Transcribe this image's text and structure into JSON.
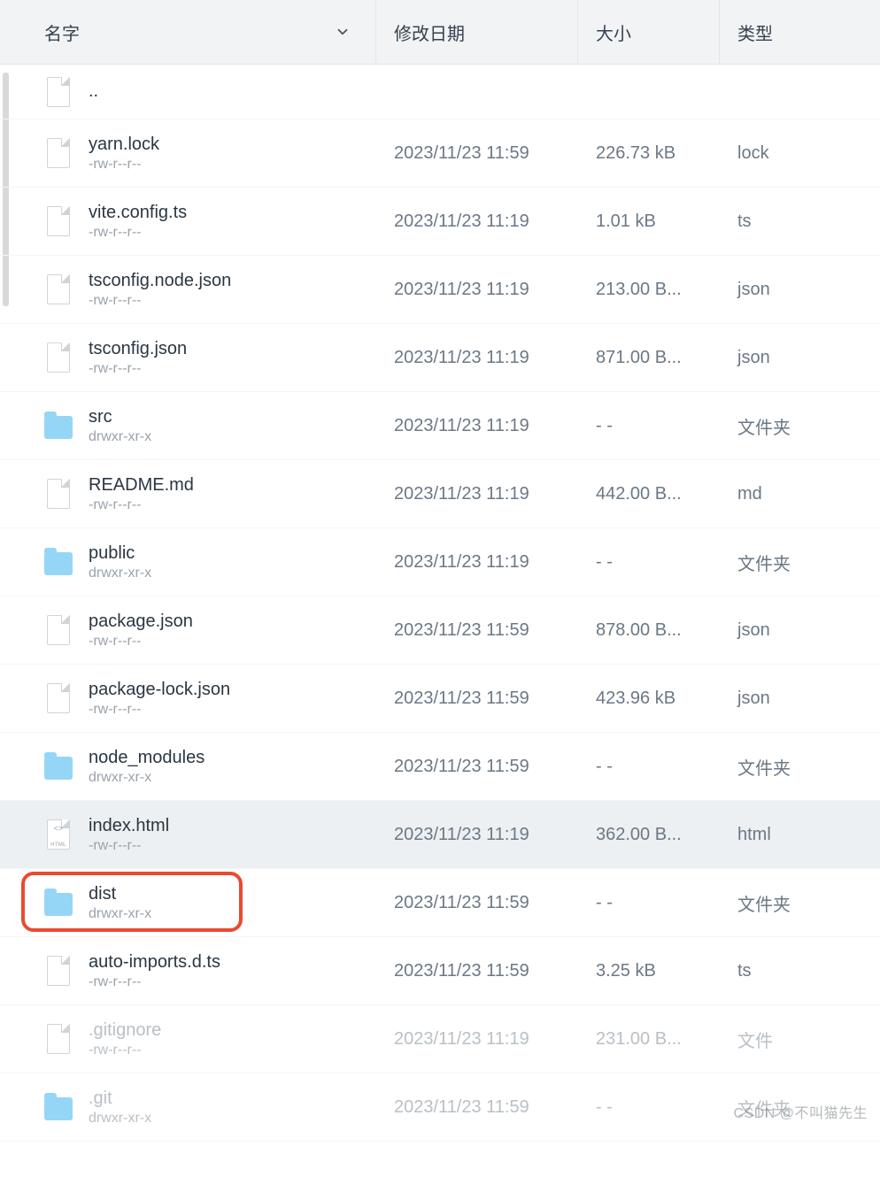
{
  "columns": {
    "name": "名字",
    "date": "修改日期",
    "size": "大小",
    "type": "类型"
  },
  "parent_label": "..",
  "folder_type_label": "文件夹",
  "file_type_label": "文件",
  "rows": [
    {
      "icon": "file",
      "name": "yarn.lock",
      "perms": "-rw-r--r--",
      "date": "2023/11/23 11:59",
      "size": "226.73 kB",
      "type": "lock"
    },
    {
      "icon": "file",
      "name": "vite.config.ts",
      "perms": "-rw-r--r--",
      "date": "2023/11/23 11:19",
      "size": "1.01 kB",
      "type": "ts"
    },
    {
      "icon": "file",
      "name": "tsconfig.node.json",
      "perms": "-rw-r--r--",
      "date": "2023/11/23 11:19",
      "size": "213.00 B...",
      "type": "json"
    },
    {
      "icon": "file",
      "name": "tsconfig.json",
      "perms": "-rw-r--r--",
      "date": "2023/11/23 11:19",
      "size": "871.00 B...",
      "type": "json"
    },
    {
      "icon": "folder",
      "name": "src",
      "perms": "drwxr-xr-x",
      "date": "2023/11/23 11:19",
      "size": "- -",
      "type": "文件夹"
    },
    {
      "icon": "file",
      "name": "README.md",
      "perms": "-rw-r--r--",
      "date": "2023/11/23 11:19",
      "size": "442.00 B...",
      "type": "md"
    },
    {
      "icon": "folder",
      "name": "public",
      "perms": "drwxr-xr-x",
      "date": "2023/11/23 11:19",
      "size": "- -",
      "type": "文件夹"
    },
    {
      "icon": "file",
      "name": "package.json",
      "perms": "-rw-r--r--",
      "date": "2023/11/23 11:59",
      "size": "878.00 B...",
      "type": "json"
    },
    {
      "icon": "file",
      "name": "package-lock.json",
      "perms": "-rw-r--r--",
      "date": "2023/11/23 11:59",
      "size": "423.96 kB",
      "type": "json"
    },
    {
      "icon": "folder",
      "name": "node_modules",
      "perms": "drwxr-xr-x",
      "date": "2023/11/23 11:59",
      "size": "- -",
      "type": "文件夹"
    },
    {
      "icon": "html",
      "name": "index.html",
      "perms": "-rw-r--r--",
      "date": "2023/11/23 11:19",
      "size": "362.00 B...",
      "type": "html",
      "hovered": true
    },
    {
      "icon": "folder",
      "name": "dist",
      "perms": "drwxr-xr-x",
      "date": "2023/11/23 11:59",
      "size": "- -",
      "type": "文件夹",
      "highlighted": true
    },
    {
      "icon": "file",
      "name": "auto-imports.d.ts",
      "perms": "-rw-r--r--",
      "date": "2023/11/23 11:59",
      "size": "3.25 kB",
      "type": "ts"
    },
    {
      "icon": "file",
      "name": ".gitignore",
      "perms": "-rw-r--r--",
      "date": "2023/11/23 11:19",
      "size": "231.00 B...",
      "type": "文件",
      "faded": true
    },
    {
      "icon": "folder",
      "name": ".git",
      "perms": "drwxr-xr-x",
      "date": "2023/11/23 11:59",
      "size": "- -",
      "type": "文件夹",
      "faded": true
    }
  ],
  "watermark": "CSDN @不叫猫先生"
}
